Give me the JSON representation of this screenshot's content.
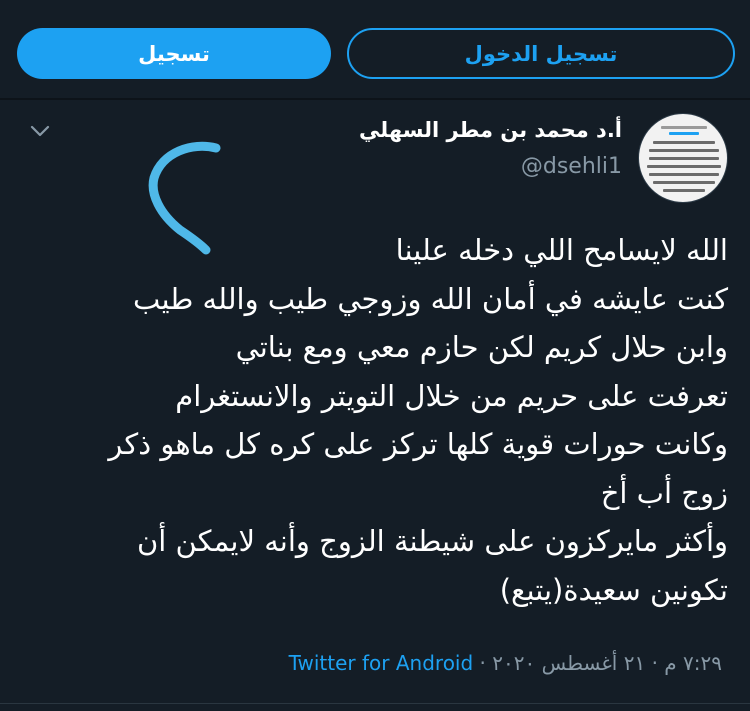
{
  "header": {
    "signup_label": "تسجيل",
    "login_label": "تسجيل الدخول"
  },
  "colors": {
    "background": "#141d26",
    "accent": "#1da1f2",
    "secondary_text": "#8899a6"
  },
  "icons": {
    "menu": "chevron-down-icon",
    "avatar": "avatar-image"
  },
  "tweet": {
    "author_name": "أ.د محمد بن مطر السهلي",
    "author_handle": "@dsehli1",
    "lines": [
      "الله لايسامح اللي دخله علينا",
      "كنت عايشه في أمان الله وزوجي طيب والله طيب",
      "وابن حلال كريم لكن حازم معي ومع بناتي",
      "تعرفت على حريم من خلال التويتر والانستغرام",
      "وكانت حورات قوية كلها تركز على كره كل ماهو ذكر",
      "زوج أب أخ",
      "وأكثر مايركزون على شيطنة الزوج وأنه لايمكن أن",
      "تكونين سعيدة(يتبع)"
    ],
    "time": "٧:٢٩ م",
    "date": "٢١ أغسطس ٢٠٢٠",
    "separator": "·",
    "source": "Twitter for Android"
  }
}
